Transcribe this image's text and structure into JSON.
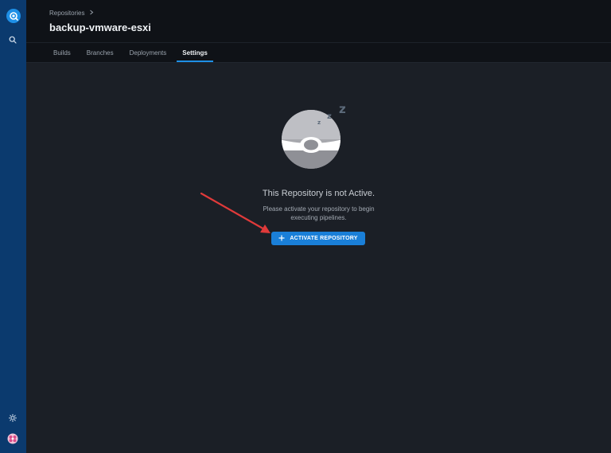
{
  "header": {
    "breadcrumb": "Repositories",
    "title": "backup-vmware-esxi"
  },
  "tabs": [
    {
      "label": "Builds"
    },
    {
      "label": "Branches"
    },
    {
      "label": "Deployments"
    },
    {
      "label": "Settings",
      "active": true
    }
  ],
  "empty_state": {
    "title": "This Repository is not Active.",
    "description_line1": "Please activate your repository to begin",
    "description_line2": "executing pipelines.",
    "button_label": "ACTIVATE REPOSITORY"
  },
  "icons": {
    "logo": "drone-logo-icon",
    "search": "search-icon",
    "theme": "sun-icon",
    "avatar": "user-avatar-icon",
    "sleep": "sleeping-drone-icon",
    "button": "plus-icon"
  },
  "colors": {
    "sidebar": "#0b3a6e",
    "accent": "#1e8fe6",
    "button": "#1a7fd8",
    "annotation_arrow": "#e03a3a"
  }
}
